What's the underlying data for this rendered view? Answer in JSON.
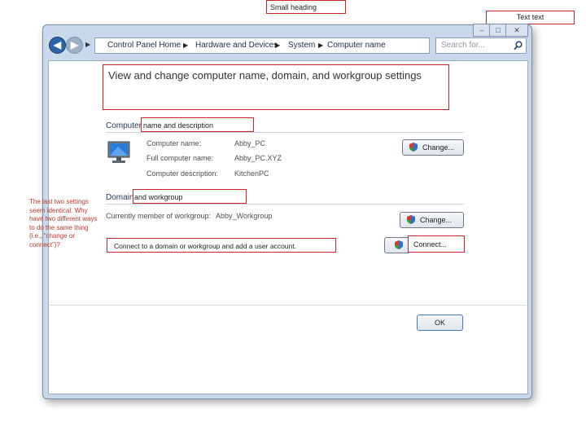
{
  "annotations": {
    "small_heading": "Small heading",
    "text_text": "Text text",
    "heading_box": "View and change computer name, domain, and workgroup settings",
    "name_box": "name and description",
    "workgroup_box": "and workgroup",
    "connect_tooltip": "Connect to a domain or workgroup and add a user account.",
    "connect_box": "Connect...",
    "side_note": "The last two settings seem identical. Why have two different ways to do the same thing (i.e., “change or connect”)?"
  },
  "window": {
    "caption_buttons": [
      "–",
      "□",
      "✕"
    ]
  },
  "nav": {
    "back": "◀",
    "forward": "▶",
    "breadcrumbs": [
      "Control Panel Home",
      "Hardware and Devices",
      "System",
      "Computer name"
    ],
    "search_placeholder": "Search for...",
    "search_icon": "magnifier-icon"
  },
  "main": {
    "section_computer": "Computer",
    "computer_rows": [
      {
        "label": "Computer name:",
        "value": "Abby_PC"
      },
      {
        "label": "Full computer name:",
        "value": "Abby_PC.XYZ"
      },
      {
        "label": "Computer description:",
        "value": "KitchenPC"
      }
    ],
    "change_button_1": "Change...",
    "section_domain": "Domain",
    "workgroup_label": "Currently member of workgroup:",
    "workgroup_value": "Abby_Workgroup",
    "change_button_2": "Change...",
    "ok_button": "OK"
  },
  "colors": {
    "annotation_red": "#d2232a",
    "link_blue": "#1e395b",
    "window_frame": "#c9d9ec"
  }
}
